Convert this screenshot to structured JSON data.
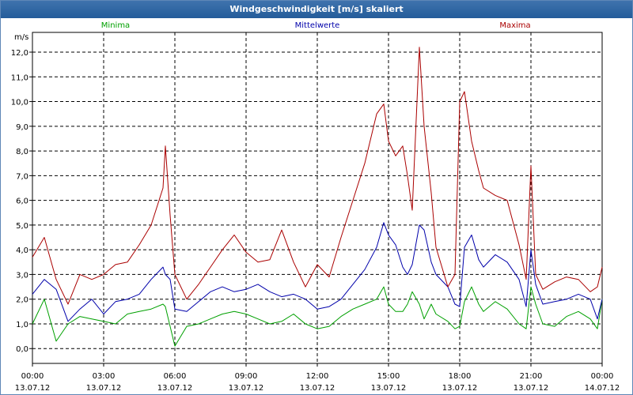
{
  "window": {
    "title": "Windgeschwindigkeit [m/s] skaliert"
  },
  "chart_data": {
    "type": "line",
    "title": "Windgeschwindigkeit [m/s] skaliert",
    "ylabel": "m/s",
    "xlabel": "",
    "ylim": [
      -0.6,
      12.8
    ],
    "y_ticks": [
      "0,0",
      "1,0",
      "2,0",
      "3,0",
      "4,0",
      "5,0",
      "6,0",
      "7,0",
      "8,0",
      "9,0",
      "10,0",
      "11,0",
      "12,0"
    ],
    "x_range_hours": [
      0,
      24
    ],
    "x_ticks": [
      {
        "time": "00:00",
        "date": "13.07.12"
      },
      {
        "time": "03:00",
        "date": "13.07.12"
      },
      {
        "time": "06:00",
        "date": "13.07.12"
      },
      {
        "time": "09:00",
        "date": "13.07.12"
      },
      {
        "time": "12:00",
        "date": "13.07.12"
      },
      {
        "time": "15:00",
        "date": "13.07.12"
      },
      {
        "time": "18:00",
        "date": "13.07.12"
      },
      {
        "time": "21:00",
        "date": "13.07.12"
      },
      {
        "time": "00:00",
        "date": "14.07.12"
      }
    ],
    "grid": true,
    "legend_position": "top",
    "x": [
      0,
      0.5,
      1,
      1.5,
      2,
      2.5,
      3,
      3.5,
      4,
      4.5,
      5,
      5.5,
      5.6,
      5.8,
      6,
      6.5,
      7,
      7.5,
      8,
      8.5,
      9,
      9.5,
      10,
      10.5,
      11,
      11.5,
      12,
      12.5,
      13,
      13.5,
      14,
      14.5,
      14.8,
      15,
      15.3,
      15.6,
      15.8,
      16,
      16.3,
      16.5,
      16.8,
      17,
      17.5,
      17.8,
      18,
      18.2,
      18.5,
      18.8,
      19,
      19.5,
      20,
      20.5,
      20.8,
      21,
      21.2,
      21.5,
      22,
      22.5,
      23,
      23.5,
      23.8,
      24
    ],
    "series": [
      {
        "name": "Minima",
        "color": "#00a000",
        "values": [
          1.0,
          2.0,
          0.3,
          1.0,
          1.3,
          1.2,
          1.1,
          1.0,
          1.4,
          1.5,
          1.6,
          1.8,
          1.7,
          0.9,
          0.1,
          0.9,
          1.0,
          1.2,
          1.4,
          1.5,
          1.4,
          1.2,
          1.0,
          1.1,
          1.4,
          1.0,
          0.8,
          0.9,
          1.3,
          1.6,
          1.8,
          2.0,
          2.5,
          1.8,
          1.5,
          1.5,
          1.8,
          2.3,
          1.8,
          1.2,
          1.8,
          1.4,
          1.1,
          0.8,
          0.9,
          1.9,
          2.5,
          1.8,
          1.5,
          1.9,
          1.6,
          1.0,
          0.8,
          2.5,
          1.8,
          1.0,
          0.9,
          1.3,
          1.5,
          1.2,
          0.8,
          2.0
        ]
      },
      {
        "name": "Mittelwerte",
        "color": "#0000aa",
        "values": [
          2.2,
          2.8,
          2.4,
          1.1,
          1.6,
          2.0,
          1.4,
          1.9,
          2.0,
          2.2,
          2.8,
          3.3,
          3.0,
          2.8,
          1.6,
          1.5,
          1.9,
          2.3,
          2.5,
          2.3,
          2.4,
          2.6,
          2.3,
          2.1,
          2.2,
          2.0,
          1.6,
          1.7,
          2.0,
          2.6,
          3.2,
          4.1,
          5.1,
          4.6,
          4.2,
          3.3,
          3.0,
          3.4,
          5.0,
          4.8,
          3.5,
          3.0,
          2.5,
          1.8,
          1.7,
          4.1,
          4.6,
          3.6,
          3.3,
          3.8,
          3.5,
          2.8,
          1.7,
          4.0,
          2.6,
          1.8,
          1.9,
          2.0,
          2.2,
          2.0,
          1.2,
          2.0
        ]
      },
      {
        "name": "Maxima",
        "color": "#aa0000",
        "values": [
          3.7,
          4.5,
          2.8,
          1.8,
          3.0,
          2.8,
          3.0,
          3.4,
          3.5,
          4.2,
          5.0,
          6.5,
          8.2,
          5.4,
          3.0,
          2.0,
          2.6,
          3.3,
          4.0,
          4.6,
          3.9,
          3.5,
          3.6,
          4.8,
          3.5,
          2.5,
          3.4,
          2.9,
          4.5,
          6.0,
          7.5,
          9.5,
          9.9,
          8.4,
          7.8,
          8.2,
          7.0,
          5.6,
          12.2,
          9.0,
          6.3,
          4.1,
          2.5,
          3.0,
          10.0,
          10.4,
          8.4,
          7.2,
          6.5,
          6.2,
          6.0,
          4.2,
          2.8,
          7.4,
          3.0,
          2.4,
          2.7,
          2.9,
          2.8,
          2.3,
          2.5,
          3.3
        ]
      }
    ]
  }
}
